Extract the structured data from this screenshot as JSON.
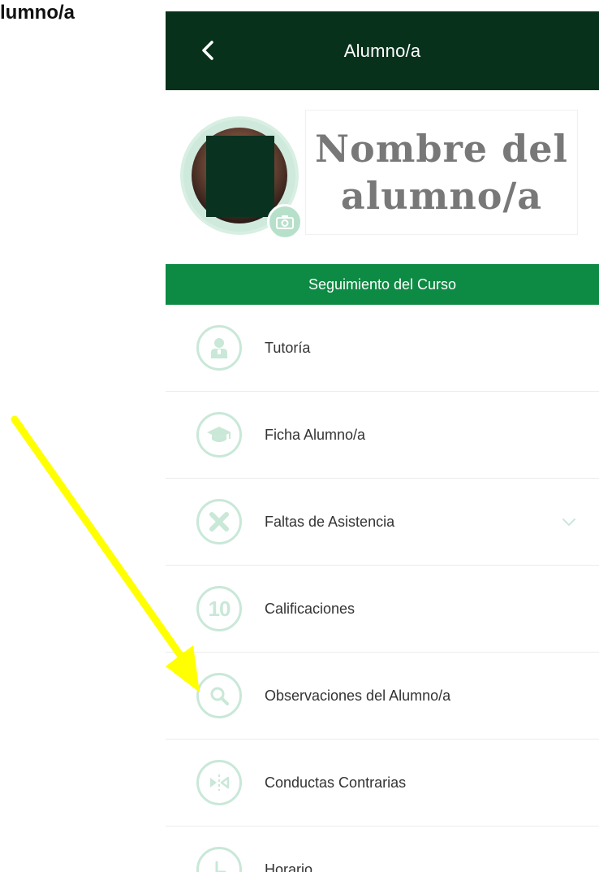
{
  "caption": "lumno/a",
  "appbar": {
    "title": "Alumno/a"
  },
  "profile": {
    "name_line1": "Nombre del",
    "name_line2": "alumno/a"
  },
  "section": {
    "title": "Seguimiento del Curso"
  },
  "menu": [
    {
      "label": "Tutoría",
      "icon": "tutor-icon"
    },
    {
      "label": "Ficha Alumno/a",
      "icon": "graduation-cap-icon"
    },
    {
      "label": "Faltas de Asistencia",
      "icon": "x-icon",
      "expandable": true
    },
    {
      "label": "Calificaciones",
      "icon": "number-ten-icon",
      "icon_text": "10"
    },
    {
      "label": "Observaciones del Alumno/a",
      "icon": "search-icon"
    },
    {
      "label": "Conductas Contrarias",
      "icon": "conduct-icon"
    },
    {
      "label": "Horario",
      "icon": "clock-icon"
    }
  ],
  "colors": {
    "appbar": "#07311b",
    "section_bar": "#0d8a43",
    "icon_green": "#c9e8d8",
    "annotation_arrow": "#ffff00"
  }
}
